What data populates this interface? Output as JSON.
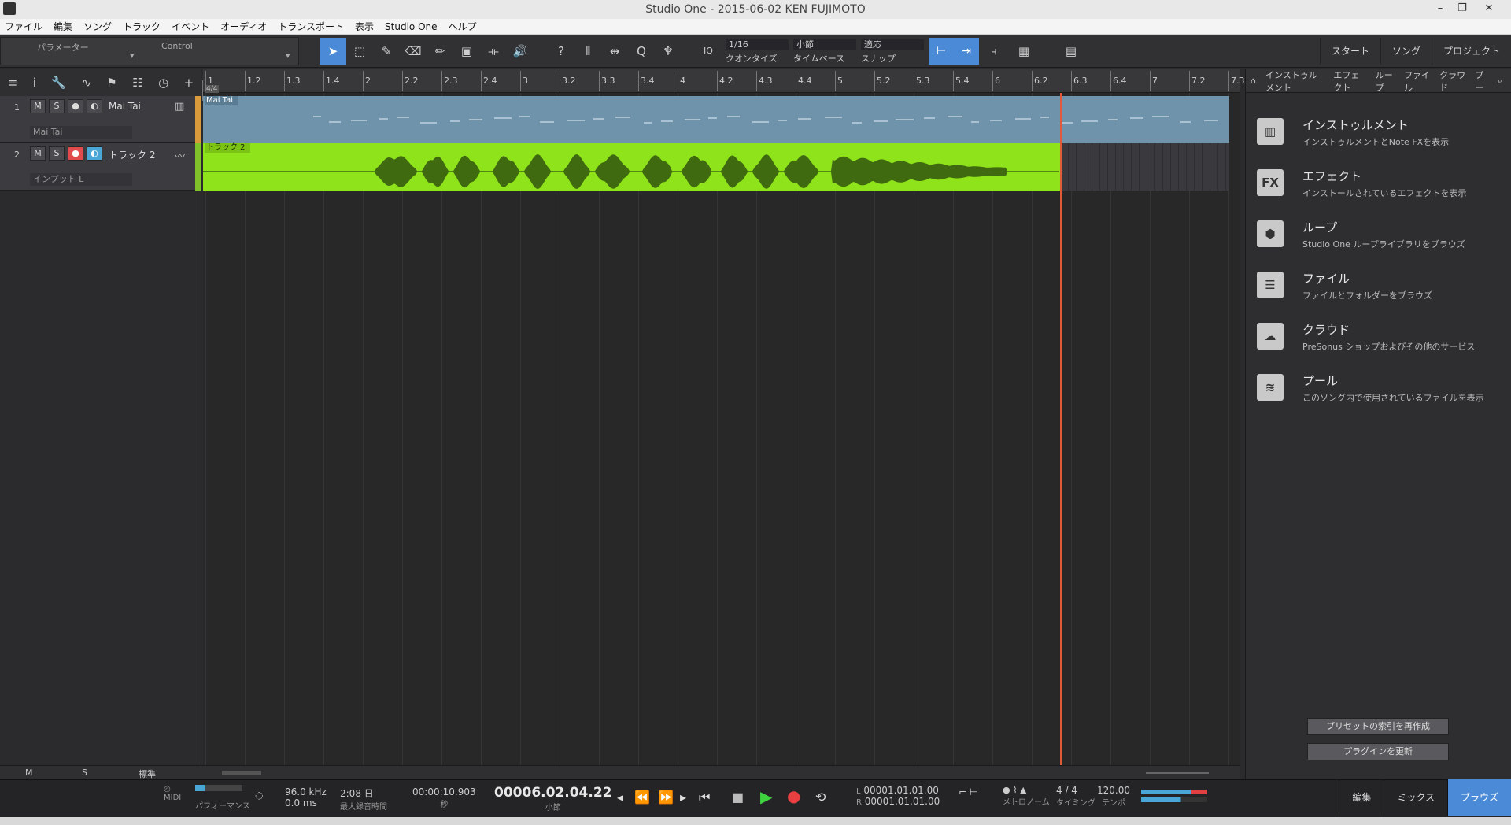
{
  "window": {
    "title": "Studio One - 2015-06-02 KEN FUJIMOTO"
  },
  "menu": [
    "ファイル",
    "編集",
    "ソング",
    "トラック",
    "イベント",
    "オーディオ",
    "トランスポート",
    "表示",
    "Studio One",
    "ヘルプ"
  ],
  "toolbar": {
    "param_label": "パラメーター",
    "control_label": "Control",
    "iq_label": "IQ",
    "quantize": {
      "value": "1/16",
      "caption": "クオンタイズ"
    },
    "timebase": {
      "value": "小節",
      "caption": "タイムベース"
    },
    "snap": {
      "value": "適応",
      "caption": "スナップ"
    },
    "right_buttons": [
      "スタート",
      "ソング",
      "プロジェクト"
    ]
  },
  "ruler": {
    "time_signature": "4/4",
    "ticks": [
      "1",
      "1.2",
      "1.3",
      "1.4",
      "2",
      "2.2",
      "2.3",
      "2.4",
      "3",
      "3.2",
      "3.3",
      "3.4",
      "4",
      "4.2",
      "4.3",
      "4.4",
      "5",
      "5.2",
      "5.3",
      "5.4",
      "6",
      "6.2",
      "6.3",
      "6.4",
      "7",
      "7.2",
      "7.3"
    ]
  },
  "tracks": [
    {
      "number": "1",
      "mute": "M",
      "solo": "S",
      "name": "Mai Tai",
      "input": "Mai Tai",
      "event_name": "Mai Tai",
      "type": "instrument",
      "color": "#6f93aa",
      "edge_color": "#d89a3a"
    },
    {
      "number": "2",
      "mute": "M",
      "solo": "S",
      "name": "トラック 2",
      "input": "インプット L",
      "event_name": "トラック 2",
      "type": "audio",
      "color": "#8fe31a",
      "edge_color": "#7fc22a"
    }
  ],
  "browser": {
    "tabs": [
      "インストゥルメント",
      "エフェクト",
      "ループ",
      "ファイル",
      "クラウド",
      "プー"
    ],
    "items": [
      {
        "title": "インストゥルメント",
        "desc": "インストゥルメントとNote FXを表示",
        "icon": "piano-icon"
      },
      {
        "title": "エフェクト",
        "desc": "インストールされているエフェクトを表示",
        "icon": "fx-icon",
        "icon_text": "FX"
      },
      {
        "title": "ループ",
        "desc": "Studio One ループライブラリをブラウズ",
        "icon": "loop-icon"
      },
      {
        "title": "ファイル",
        "desc": "ファイルとフォルダーをブラウズ",
        "icon": "file-icon"
      },
      {
        "title": "クラウド",
        "desc": "PreSonus ショップおよびその他のサービス",
        "icon": "cloud-icon"
      },
      {
        "title": "プール",
        "desc": "このソング内で使用されているファイルを表示",
        "icon": "pool-icon"
      }
    ],
    "rebuild_preset_index": "プリセットの索引を再作成",
    "update_plugins": "プラグインを更新"
  },
  "arrange_footer": {
    "m": "M",
    "s": "S",
    "mode": "標準"
  },
  "transport": {
    "midi": "MIDI",
    "performance": "パフォーマンス",
    "sample_rate": "96.0 kHz",
    "latency": "0.0 ms",
    "record_time": "2:08 日",
    "record_time_label": "最大録音時間",
    "seconds": "00:00:10.903",
    "seconds_label": "秒",
    "bars": "00006.02.04.22",
    "bars_label": "小節",
    "loop_l": "00001.01.01.00",
    "loop_r": "00001.01.01.00",
    "loop_l_label": "L",
    "loop_r_label": "R",
    "metronome": "メトロノーム",
    "time_sig": "4 / 4",
    "timing": "タイミング",
    "tempo": "120.00",
    "tempo_label": "テンポ"
  },
  "bottom_tabs": [
    "編集",
    "ミックス",
    "ブラウズ"
  ]
}
